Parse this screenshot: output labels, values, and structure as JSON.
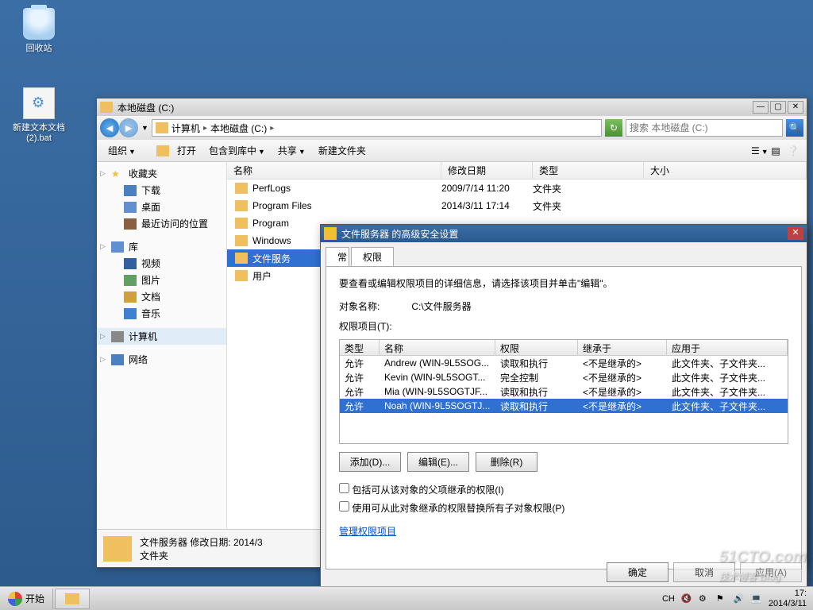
{
  "desktop": {
    "recycle": "回收站",
    "batfile": "新建文本文档\n(2).bat"
  },
  "explorer": {
    "title": "本地磁盘 (C:)",
    "breadcrumb": {
      "computer": "计算机",
      "drive": "本地磁盘 (C:)",
      "arrow": "▸"
    },
    "search_placeholder": "搜索 本地磁盘 (C:)",
    "toolbar": {
      "organize": "组织",
      "open": "打开",
      "include": "包含到库中",
      "share": "共享",
      "newfolder": "新建文件夹"
    },
    "columns": {
      "name": "名称",
      "date": "修改日期",
      "type": "类型",
      "size": "大小"
    },
    "sidebar": {
      "favorites": "收藏夹",
      "downloads": "下载",
      "desktop": "桌面",
      "recent": "最近访问的位置",
      "library": "库",
      "video": "视频",
      "picture": "图片",
      "doc": "文档",
      "music": "音乐",
      "computer": "计算机",
      "network": "网络"
    },
    "files": [
      {
        "name": "PerfLogs",
        "date": "2009/7/14 11:20",
        "type": "文件夹"
      },
      {
        "name": "Program Files",
        "date": "2014/3/11 17:14",
        "type": "文件夹"
      },
      {
        "name": "Program",
        "date": "",
        "type": ""
      },
      {
        "name": "Windows",
        "date": "",
        "type": ""
      },
      {
        "name": "文件服务",
        "date": "",
        "type": "",
        "selected": true
      },
      {
        "name": "用户",
        "date": "",
        "type": ""
      }
    ],
    "status": {
      "line1": "文件服务器 修改日期: 2014/3",
      "line2": "文件夹"
    }
  },
  "dialog": {
    "title": "文件服务器 的高级安全设置",
    "tab1": "常",
    "tab2": "权限",
    "info": "要查看或编辑权限项目的详细信息，请选择该项目并单击\"编辑\"。",
    "object_label": "对象名称:",
    "object_value": "C:\\文件服务器",
    "perm_label": "权限项目(T):",
    "cols": {
      "type": "类型",
      "name": "名称",
      "perm": "权限",
      "inherit": "继承于",
      "apply": "应用于"
    },
    "rows": [
      {
        "type": "允许",
        "name": "Andrew (WIN-9L5SOG...",
        "perm": "读取和执行",
        "inherit": "<不是继承的>",
        "apply": "此文件夹、子文件夹..."
      },
      {
        "type": "允许",
        "name": "Kevin (WIN-9L5SOGT...",
        "perm": "完全控制",
        "inherit": "<不是继承的>",
        "apply": "此文件夹、子文件夹..."
      },
      {
        "type": "允许",
        "name": "Mia (WIN-9L5SOGTJF...",
        "perm": "读取和执行",
        "inherit": "<不是继承的>",
        "apply": "此文件夹、子文件夹..."
      },
      {
        "type": "允许",
        "name": "Noah (WIN-9L5SOGTJ...",
        "perm": "读取和执行",
        "inherit": "<不是继承的>",
        "apply": "此文件夹、子文件夹...",
        "selected": true
      }
    ],
    "btns": {
      "add": "添加(D)...",
      "edit": "编辑(E)...",
      "remove": "删除(R)"
    },
    "check1": "包括可从该对象的父项继承的权限(I)",
    "check2": "使用可从此对象继承的权限替换所有子对象权限(P)",
    "link": "管理权限项目",
    "footer": {
      "ok": "确定",
      "cancel": "取消",
      "apply": "应用(A)"
    }
  },
  "taskbar": {
    "start": "开始",
    "lang": "CH",
    "time": "17:",
    "date": "2014/3/11"
  },
  "watermark": {
    "main": "51CTO.com",
    "sub": "技术博客",
    "suffix": "Blog"
  }
}
